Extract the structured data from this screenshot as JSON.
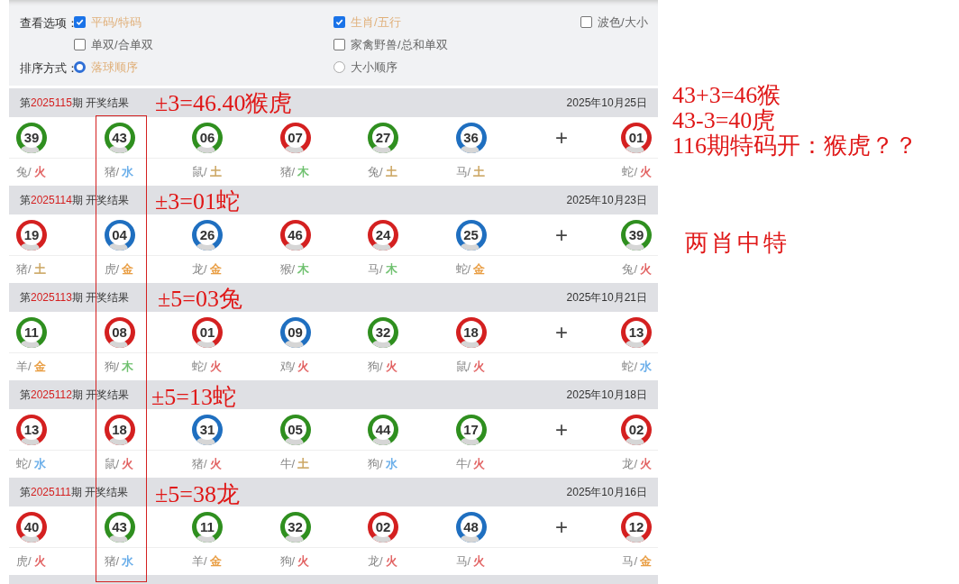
{
  "options": {
    "rows": [
      {
        "label": "查看选项：",
        "items": [
          {
            "kind": "checkbox",
            "text": "平码/特码",
            "checked": true
          },
          {
            "kind": "checkbox",
            "text": "生肖/五行",
            "checked": true
          },
          {
            "kind": "checkbox",
            "text": "波色/大小",
            "checked": false
          }
        ]
      },
      {
        "items": [
          {
            "kind": "checkbox",
            "text": "单双/合单双",
            "checked": false
          },
          {
            "kind": "checkbox",
            "text": "家禽野兽/总和单双",
            "checked": false
          }
        ]
      },
      {
        "label": "排序方式：",
        "items": [
          {
            "kind": "radio",
            "text": "落球顺序",
            "selected": true
          },
          {
            "kind": "radio",
            "text": "大小顺序",
            "selected": false
          }
        ]
      }
    ]
  },
  "draws": [
    {
      "prefix": "第",
      "period": "2025115",
      "suffix": "期 开奖结果",
      "date": "2025年10月25日",
      "plus": "+",
      "balls": [
        {
          "number": "39",
          "color": "#2f8f1f",
          "zodiac": "兔/",
          "element": {
            "text": "火",
            "color": "#e05a5a"
          }
        },
        {
          "number": "43",
          "color": "#2f8f1f",
          "zodiac": "猪/",
          "element": {
            "text": "水",
            "color": "#5fa8e8"
          }
        },
        {
          "number": "06",
          "color": "#2f8f1f",
          "zodiac": "鼠/",
          "element": {
            "text": "土",
            "color": "#c9a15a"
          }
        },
        {
          "number": "07",
          "color": "#d42020",
          "zodiac": "猪/",
          "element": {
            "text": "木",
            "color": "#6cbf6c"
          }
        },
        {
          "number": "27",
          "color": "#2f8f1f",
          "zodiac": "兔/",
          "element": {
            "text": "土",
            "color": "#c9a15a"
          }
        },
        {
          "number": "36",
          "color": "#1f6fc0",
          "zodiac": "马/",
          "element": {
            "text": "土",
            "color": "#c9a15a"
          }
        },
        {
          "number": "01",
          "color": "#d42020",
          "zodiac": "蛇/",
          "element": {
            "text": "火",
            "color": "#e05a5a"
          }
        }
      ]
    },
    {
      "prefix": "第",
      "period": "2025114",
      "suffix": "期 开奖结果",
      "date": "2025年10月23日",
      "plus": "+",
      "balls": [
        {
          "number": "19",
          "color": "#d42020",
          "zodiac": "猪/",
          "element": {
            "text": "土",
            "color": "#c9a15a"
          }
        },
        {
          "number": "04",
          "color": "#1f6fc0",
          "zodiac": "虎/",
          "element": {
            "text": "金",
            "color": "#e89a3c"
          }
        },
        {
          "number": "26",
          "color": "#1f6fc0",
          "zodiac": "龙/",
          "element": {
            "text": "金",
            "color": "#e89a3c"
          }
        },
        {
          "number": "46",
          "color": "#d42020",
          "zodiac": "猴/",
          "element": {
            "text": "木",
            "color": "#6cbf6c"
          }
        },
        {
          "number": "24",
          "color": "#d42020",
          "zodiac": "马/",
          "element": {
            "text": "木",
            "color": "#6cbf6c"
          }
        },
        {
          "number": "25",
          "color": "#1f6fc0",
          "zodiac": "蛇/",
          "element": {
            "text": "金",
            "color": "#e89a3c"
          }
        },
        {
          "number": "39",
          "color": "#2f8f1f",
          "zodiac": "兔/",
          "element": {
            "text": "火",
            "color": "#e05a5a"
          }
        }
      ]
    },
    {
      "prefix": "第",
      "period": "2025113",
      "suffix": "期 开奖结果",
      "date": "2025年10月21日",
      "plus": "+",
      "balls": [
        {
          "number": "11",
          "color": "#2f8f1f",
          "zodiac": "羊/",
          "element": {
            "text": "金",
            "color": "#e89a3c"
          }
        },
        {
          "number": "08",
          "color": "#d42020",
          "zodiac": "狗/",
          "element": {
            "text": "木",
            "color": "#6cbf6c"
          }
        },
        {
          "number": "01",
          "color": "#d42020",
          "zodiac": "蛇/",
          "element": {
            "text": "火",
            "color": "#e05a5a"
          }
        },
        {
          "number": "09",
          "color": "#1f6fc0",
          "zodiac": "鸡/",
          "element": {
            "text": "火",
            "color": "#e05a5a"
          }
        },
        {
          "number": "32",
          "color": "#2f8f1f",
          "zodiac": "狗/",
          "element": {
            "text": "火",
            "color": "#e05a5a"
          }
        },
        {
          "number": "18",
          "color": "#d42020",
          "zodiac": "鼠/",
          "element": {
            "text": "火",
            "color": "#e05a5a"
          }
        },
        {
          "number": "13",
          "color": "#d42020",
          "zodiac": "蛇/",
          "element": {
            "text": "水",
            "color": "#5fa8e8"
          }
        }
      ]
    },
    {
      "prefix": "第",
      "period": "2025112",
      "suffix": "期 开奖结果",
      "date": "2025年10月18日",
      "plus": "+",
      "balls": [
        {
          "number": "13",
          "color": "#d42020",
          "zodiac": "蛇/",
          "element": {
            "text": "水",
            "color": "#5fa8e8"
          }
        },
        {
          "number": "18",
          "color": "#d42020",
          "zodiac": "鼠/",
          "element": {
            "text": "火",
            "color": "#e05a5a"
          }
        },
        {
          "number": "31",
          "color": "#1f6fc0",
          "zodiac": "猪/",
          "element": {
            "text": "火",
            "color": "#e05a5a"
          }
        },
        {
          "number": "05",
          "color": "#2f8f1f",
          "zodiac": "牛/",
          "element": {
            "text": "土",
            "color": "#c9a15a"
          }
        },
        {
          "number": "44",
          "color": "#2f8f1f",
          "zodiac": "狗/",
          "element": {
            "text": "水",
            "color": "#5fa8e8"
          }
        },
        {
          "number": "17",
          "color": "#2f8f1f",
          "zodiac": "牛/",
          "element": {
            "text": "火",
            "color": "#e05a5a"
          }
        },
        {
          "number": "02",
          "color": "#d42020",
          "zodiac": "龙/",
          "element": {
            "text": "火",
            "color": "#e05a5a"
          }
        }
      ]
    },
    {
      "prefix": "第",
      "period": "2025111",
      "suffix": "期 开奖结果",
      "date": "2025年10月16日",
      "plus": "+",
      "balls": [
        {
          "number": "40",
          "color": "#d42020",
          "zodiac": "虎/",
          "element": {
            "text": "火",
            "color": "#e05a5a"
          }
        },
        {
          "number": "43",
          "color": "#2f8f1f",
          "zodiac": "猪/",
          "element": {
            "text": "水",
            "color": "#5fa8e8"
          }
        },
        {
          "number": "11",
          "color": "#2f8f1f",
          "zodiac": "羊/",
          "element": {
            "text": "金",
            "color": "#e89a3c"
          }
        },
        {
          "number": "32",
          "color": "#2f8f1f",
          "zodiac": "狗/",
          "element": {
            "text": "火",
            "color": "#e05a5a"
          }
        },
        {
          "number": "02",
          "color": "#d42020",
          "zodiac": "龙/",
          "element": {
            "text": "火",
            "color": "#e05a5a"
          }
        },
        {
          "number": "48",
          "color": "#1f6fc0",
          "zodiac": "马/",
          "element": {
            "text": "火",
            "color": "#e05a5a"
          }
        },
        {
          "number": "12",
          "color": "#d42020",
          "zodiac": "马/",
          "element": {
            "text": "金",
            "color": "#e89a3c"
          }
        }
      ]
    }
  ],
  "row_annotations": [
    "±3=46.40猴虎",
    "±3=01蛇",
    "±5=03兔",
    "±5=13蛇",
    "±5=38龙"
  ],
  "side_notes": [
    "43+3=46猴",
    "43-3=40虎",
    "116期特码开：猴虎？？"
  ],
  "conclusion": "两肖中特"
}
